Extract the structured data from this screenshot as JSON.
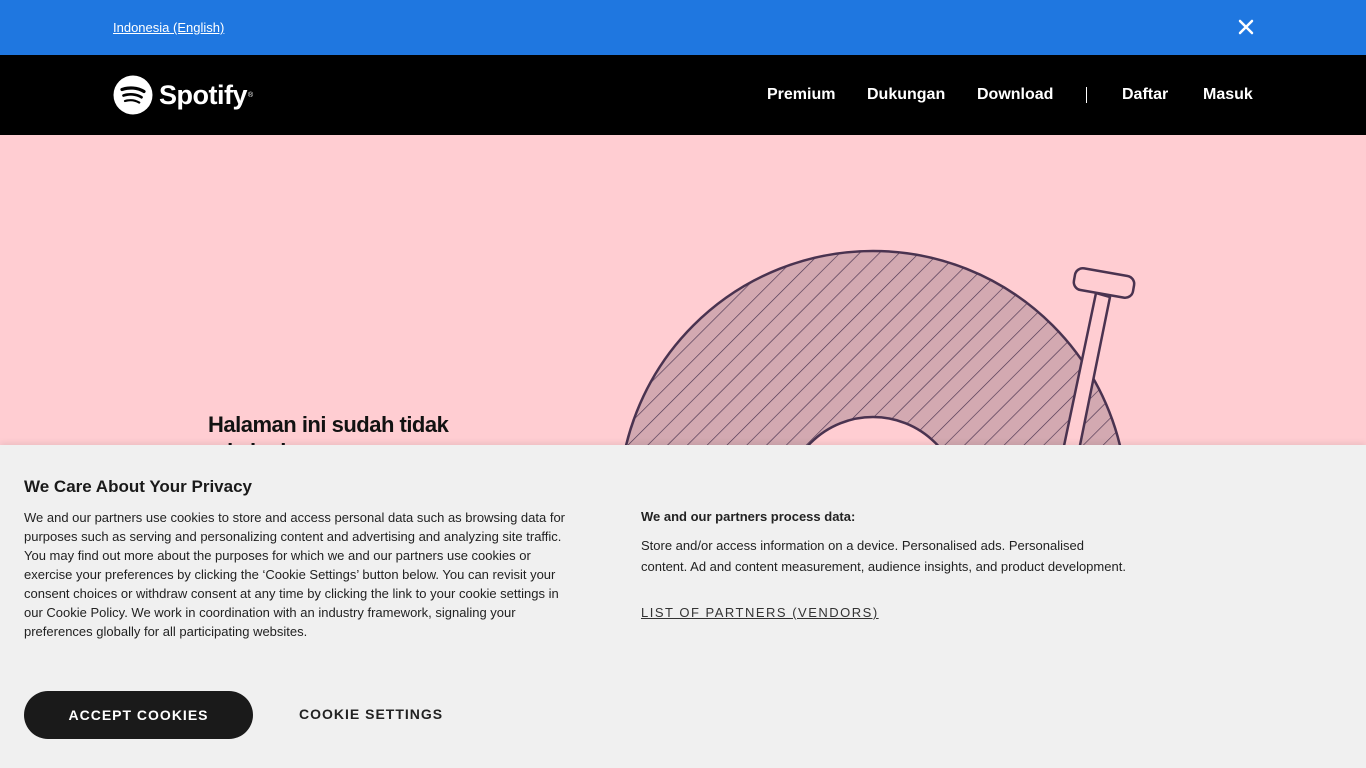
{
  "banner": {
    "locale_link": "Indonesia (English)"
  },
  "nav": {
    "brand": "Spotify",
    "items": [
      {
        "label": "Premium"
      },
      {
        "label": "Dukungan"
      },
      {
        "label": "Download"
      },
      {
        "label": "Daftar"
      },
      {
        "label": "Masuk"
      }
    ]
  },
  "hero": {
    "title": "Halaman ini sudah tidak ada lagi"
  },
  "cookie": {
    "title": "We Care About Your Privacy",
    "body": "We and our partners use cookies to store and access personal data such as browsing data for purposes such as serving and personalizing content and advertising and analyzing site traffic. You may find out more about the purposes for which we and our partners use cookies or exercise your preferences by clicking the ‘Cookie Settings’ button below. You can revisit your consent choices or withdraw consent at any time by clicking the link to your cookie settings in our Cookie Policy. We work in coordination with an industry framework, signaling your preferences globally for all participating websites.",
    "partners_heading": "We and our partners process data:",
    "partners_body": "Store and/or access information on a device. Personalised ads. Personalised content. Ad and content measurement, audience insights, and product development.",
    "partners_link": "LIST OF PARTNERS (VENDORS)",
    "accept_label": "ACCEPT COOKIES",
    "settings_label": "COOKIE SETTINGS"
  },
  "colors": {
    "banner": "#1f77e0",
    "navbar": "#000000",
    "hero_bg": "#ffcdd2",
    "panel_bg": "#f0f0f0",
    "vinyl_fill": "#d3a9b1",
    "vinyl_stroke": "#4a3350"
  }
}
